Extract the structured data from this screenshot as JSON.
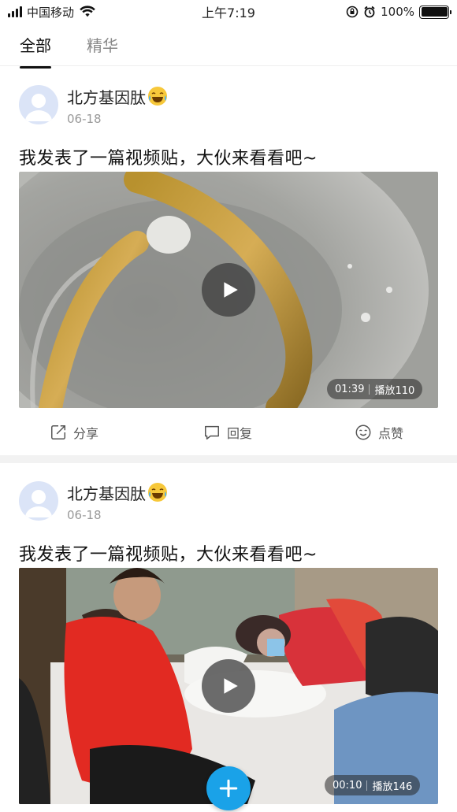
{
  "status_bar": {
    "carrier": "中国移动",
    "time": "上午7:19",
    "battery": "100%"
  },
  "tabs": [
    {
      "label": "全部",
      "active": true
    },
    {
      "label": "精华",
      "active": false
    }
  ],
  "posts": [
    {
      "author": "北方基因肽",
      "date": "06-18",
      "title": "我发表了一篇视频贴，大伙来看看吧~",
      "duration": "01:39",
      "plays": "播放110",
      "actions": {
        "share": "分享",
        "reply": "回复",
        "like": "点赞"
      }
    },
    {
      "author": "北方基因肽",
      "date": "06-18",
      "title": "我发表了一篇视频贴，大伙来看看吧~",
      "duration": "00:10",
      "plays": "播放146"
    }
  ],
  "colors": {
    "accent": "#1aa2e8"
  }
}
